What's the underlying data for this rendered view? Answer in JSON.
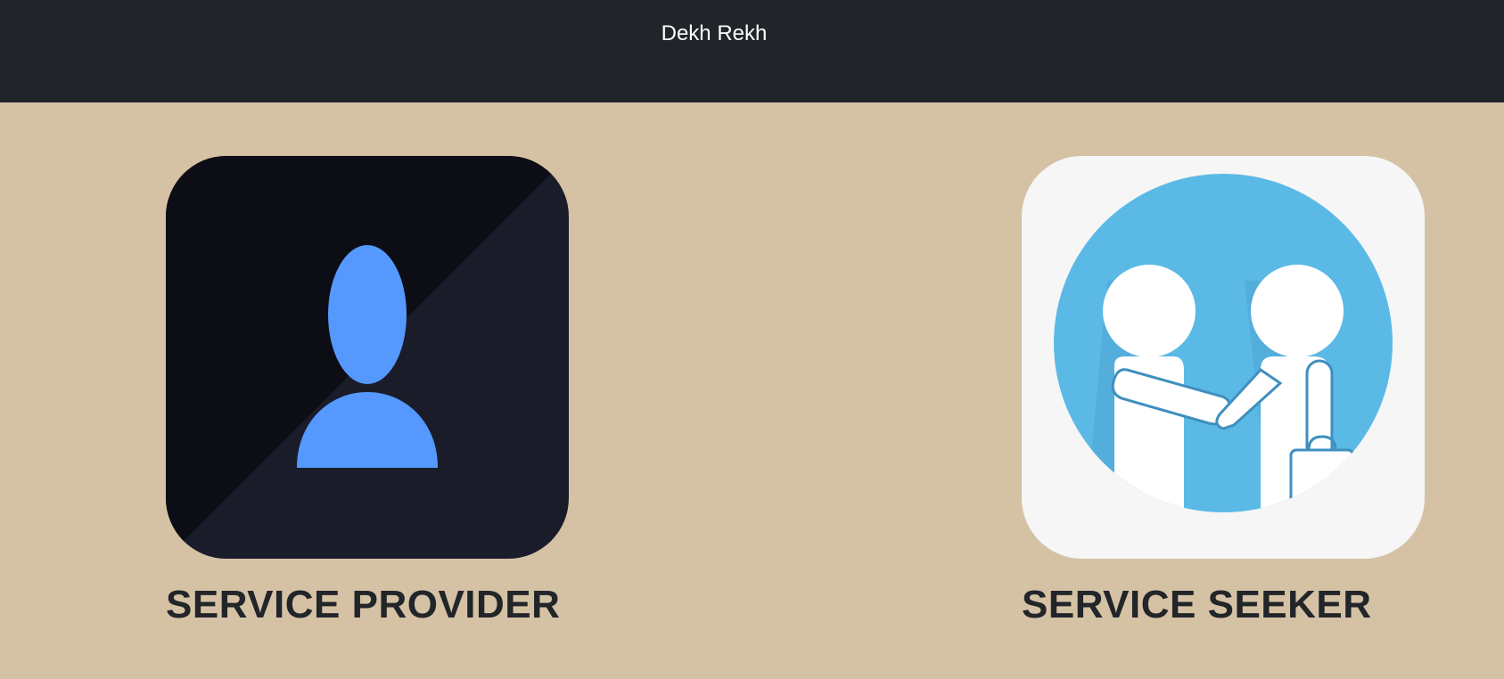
{
  "header": {
    "brand": "Dekh Rekh"
  },
  "cards": {
    "provider": {
      "label": "SERVICE PROVIDER",
      "icon": "user-silhouette-icon"
    },
    "seeker": {
      "label": "SERVICE SEEKER",
      "icon": "handshake-icon"
    }
  },
  "colors": {
    "navbar_bg": "#212429",
    "page_bg": "#d5c2a5",
    "provider_tile_dark": "#0d0d16",
    "provider_tile_light": "#1b1c2a",
    "provider_icon": "#5599ff",
    "seeker_tile_bg": "#f6f6f6",
    "seeker_circle": "#5bb9e6",
    "label_text": "#222529"
  }
}
